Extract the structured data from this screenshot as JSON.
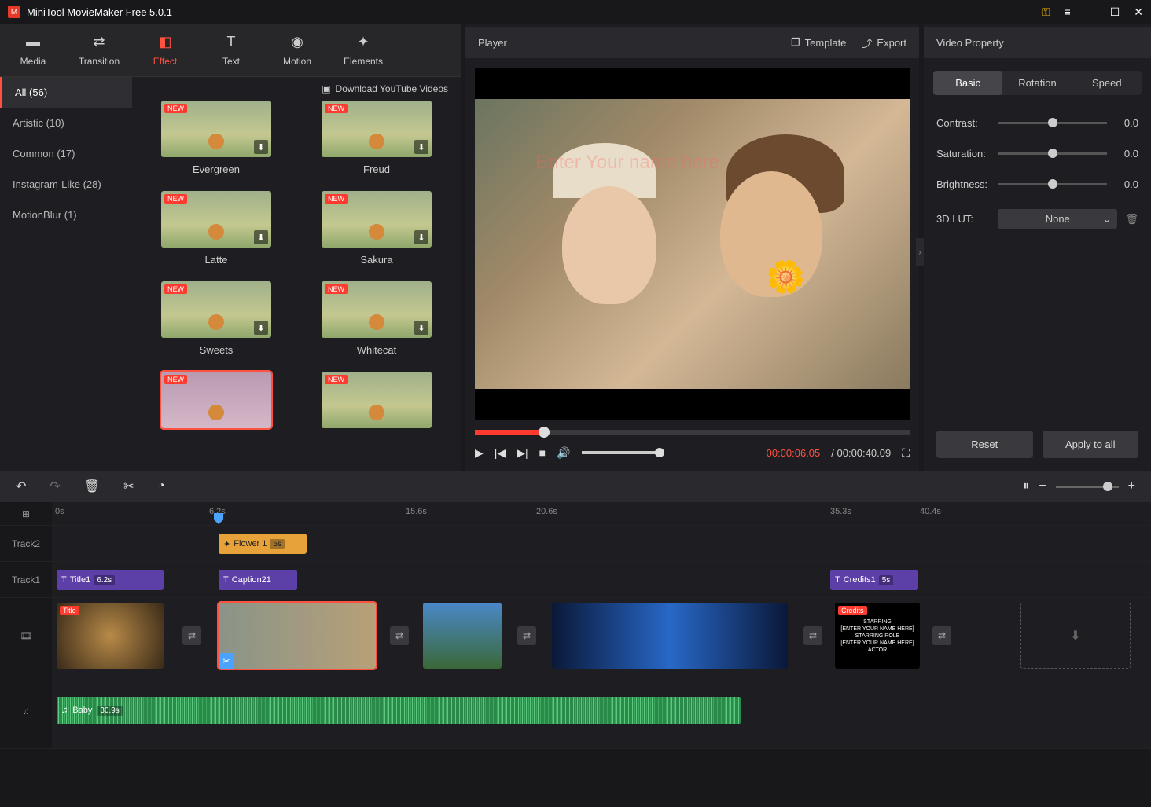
{
  "app": {
    "title": "MiniTool MovieMaker Free 5.0.1"
  },
  "topTabs": [
    {
      "label": "Media"
    },
    {
      "label": "Transition"
    },
    {
      "label": "Effect"
    },
    {
      "label": "Text"
    },
    {
      "label": "Motion"
    },
    {
      "label": "Elements"
    }
  ],
  "sidebar": {
    "items": [
      {
        "label": "All (56)"
      },
      {
        "label": "Artistic (10)"
      },
      {
        "label": "Common (17)"
      },
      {
        "label": "Instagram-Like (28)"
      },
      {
        "label": "MotionBlur (1)"
      }
    ],
    "ytDownload": "Download YouTube Videos"
  },
  "gallery": [
    {
      "name": "Evergreen"
    },
    {
      "name": "Freud"
    },
    {
      "name": "Latte"
    },
    {
      "name": "Sakura"
    },
    {
      "name": "Sweets"
    },
    {
      "name": "Whitecat"
    },
    {
      "name": ""
    },
    {
      "name": ""
    }
  ],
  "player": {
    "title": "Player",
    "template": "Template",
    "export": "Export",
    "overlayText": "Enter Your name here",
    "currentTime": "00:00:06.05",
    "totalTime": "/ 00:00:40.09"
  },
  "props": {
    "title": "Video Property",
    "tabs": [
      "Basic",
      "Rotation",
      "Speed"
    ],
    "contrast": {
      "label": "Contrast:",
      "val": "0.0"
    },
    "saturation": {
      "label": "Saturation:",
      "val": "0.0"
    },
    "brightness": {
      "label": "Brightness:",
      "val": "0.0"
    },
    "lut": {
      "label": "3D LUT:",
      "value": "None"
    },
    "reset": "Reset",
    "apply": "Apply to all"
  },
  "ruler": [
    "0s",
    "6.2s",
    "15.6s",
    "20.6s",
    "35.3s",
    "40.4s"
  ],
  "tracks": {
    "t2": "Track2",
    "t1": "Track1",
    "flower": {
      "name": "Flower 1",
      "dur": "5s"
    },
    "title1": {
      "name": "Title1",
      "dur": "6.2s"
    },
    "caption": {
      "name": "Caption21"
    },
    "credits": {
      "name": "Credits1",
      "dur": "5s"
    },
    "vTitle": "Title",
    "vCredits": "Credits",
    "creditsLines": [
      "STARRING",
      "[ENTER YOUR NAME HERE]",
      "STARRING ROLE",
      "[ENTER YOUR NAME HERE]",
      "ACTOR"
    ],
    "audio": {
      "name": "Baby",
      "dur": "30.9s"
    }
  }
}
